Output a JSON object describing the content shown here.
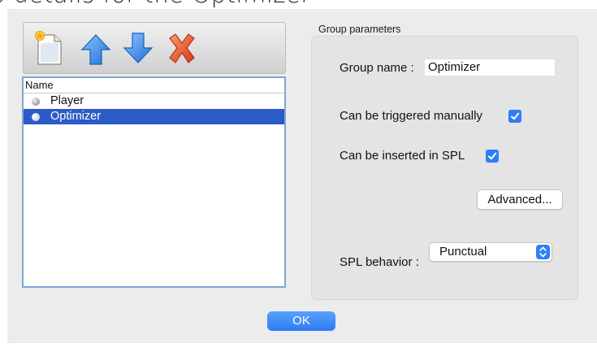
{
  "heading": {
    "text": "p details for the Optimizer"
  },
  "toolbar": {
    "buttons": [
      {
        "icon": "new-document-icon",
        "interactable": true
      },
      {
        "icon": "arrow-up-icon",
        "interactable": true
      },
      {
        "icon": "arrow-down-icon",
        "interactable": true
      },
      {
        "icon": "delete-x-icon",
        "interactable": true
      }
    ]
  },
  "list": {
    "header": "Name",
    "items": [
      {
        "label": "Player",
        "selected": false
      },
      {
        "label": "Optimizer",
        "selected": true
      }
    ]
  },
  "group": {
    "title": "Group parameters",
    "name_label": "Group name :",
    "name_value": "Optimizer",
    "manual_label": "Can be triggered manually",
    "manual_checked": true,
    "spl_label": "Can be inserted in SPL",
    "spl_checked": true,
    "advanced_label": "Advanced...",
    "behavior_label": "SPL behavior :",
    "behavior_value": "Punctual"
  },
  "ok_label": "OK",
  "colors": {
    "selection": "#2c5bc6",
    "accent": "#2f7ef7",
    "delete": "#e8542a",
    "arrow": "#3d8fe8"
  }
}
